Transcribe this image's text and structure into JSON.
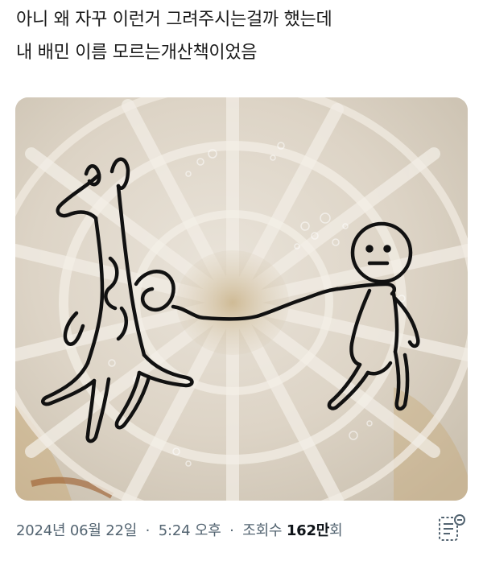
{
  "post": {
    "text_line_1": "아니 왜 자꾸 이런거 그려주시는걸까 했는데",
    "text_line_2": "내 배민 이름 모르는개산책이었음"
  },
  "meta": {
    "date": "2024년 06월 22일",
    "separator": "·",
    "time": "5:24 오후",
    "views_label": "조회수",
    "views_count": "162만",
    "views_suffix": "회"
  },
  "icons": {
    "analytics": "post-analytics-icon"
  },
  "colors": {
    "text": "#0f1419",
    "secondary": "#536471",
    "ink": "#111111"
  }
}
